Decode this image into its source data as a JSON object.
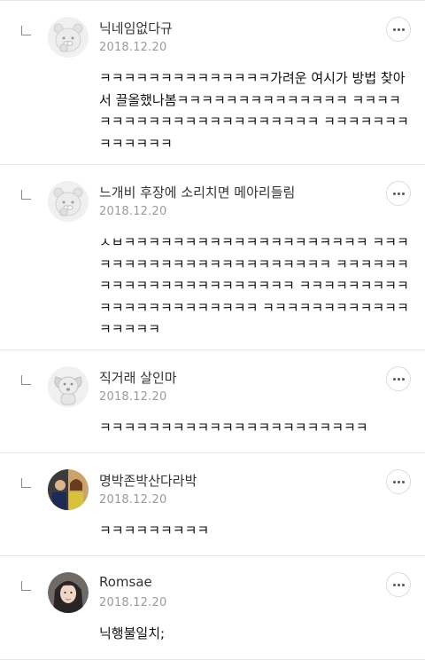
{
  "comments": [
    {
      "nickname": "닉네임없다규",
      "date": "2018.12.20",
      "text": "ㅋㅋㅋㅋㅋㅋㅋㅋㅋㅋㅋㅋㅋㅋ가려운 여시가 방법 찾아서 끌올했나봄ㅋㅋㅋㅋㅋㅋㅋㅋㅋㅋㅋㅋㅋㅋ ㅋㅋㅋㅋㅋㅋㅋㅋㅋㅋㅋㅋㅋㅋㅋㅋㅋㅋㅋㅋㅋㅋ ㅋㅋㅋㅋㅋㅋㅋㅋㅋㅋㅋㅋㅋ",
      "avatar": "ryan-character-icon"
    },
    {
      "nickname": "느개비 후장에 소리치면 메아리들림",
      "date": "2018.12.20",
      "text": "ㅅㅂㅋㅋㅋㅋㅋㅋㅋㅋㅋㅋㅋㅋㅋㅋㅋㅋㅋㅋㅋㅋ ㅋㅋㅋㅋㅋㅋㅋㅋㅋㅋㅋㅋㅋㅋㅋㅋㅋㅋㅋㅋㅋㅋ ㅋㅋㅋㅋㅋㅋㅋㅋㅋㅋㅋㅋㅋㅋㅋㅋㅋㅋㅋㅋㅋㅋ ㅋㅋㅋㅋㅋㅋㅋㅋㅋㅋㅋㅋㅋㅋㅋㅋㅋㅋㅋㅋㅋㅋ ㅋㅋㅋㅋㅋㅋㅋㅋㅋㅋㅋㅋㅋㅋㅋㅋㅋ",
      "avatar": "ryan-character-icon"
    },
    {
      "nickname": "직거래 살인마",
      "date": "2018.12.20",
      "text": "ㅋㅋㅋㅋㅋㅋㅋㅋㅋㅋㅋㅋㅋㅋㅋㅋㅋㅋㅋㅋㅋㅋ",
      "avatar": "dog-character-icon"
    },
    {
      "nickname": "명박존박산다라박",
      "date": "2018.12.20",
      "text": "ㅋㅋㅋㅋㅋㅋㅋㅋㅋ",
      "avatar": "photo-avatar"
    },
    {
      "nickname": "Romsae",
      "date": "2018.12.20",
      "text": "닉행불일치;",
      "avatar": "photo-avatar"
    }
  ],
  "colors": {
    "divider": "#e6e6e6",
    "date": "#9a9a9a",
    "text": "#111111"
  }
}
